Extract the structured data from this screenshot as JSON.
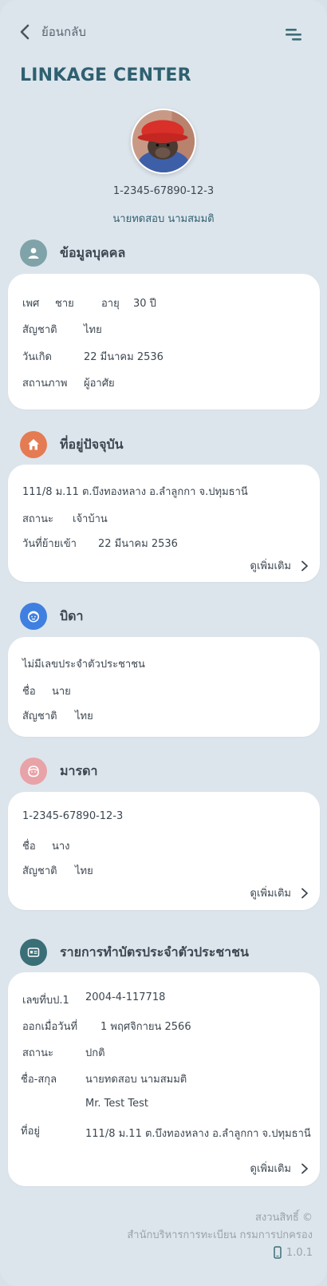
{
  "header": {
    "back_label": "ย้อนกลับ",
    "title": "LINKAGE CENTER"
  },
  "profile": {
    "id_number": "1-2345-67890-12-3",
    "name": "นายทดสอบ  นามสมมติ"
  },
  "personal": {
    "title": "ข้อมูลบุคคล",
    "icon": "person-icon",
    "icon_color": "#7fa3a8",
    "gender_label": "เพศ",
    "gender_value": "ชาย",
    "age_label": "อายุ",
    "age_value": "30  ปี",
    "nationality_label": "สัญชาติ",
    "nationality_value": "ไทย",
    "birthdate_label": "วันเกิด",
    "birthdate_value": "22  มีนาคม  2536",
    "status_label": "สถานภาพ",
    "status_value": "ผู้อาศัย"
  },
  "address": {
    "title": "ที่อยู่ปัจจุบัน",
    "icon": "home-icon",
    "icon_color": "#e57b52",
    "address_text": "111/8 ม.11 ต.บึงทองหลาง อ.ลำลูกกา จ.ปทุมธานี",
    "status_label": "สถานะ",
    "status_value": "เจ้าบ้าน",
    "movein_label": "วันที่ย้ายเข้า",
    "movein_value": "22 มีนาคม 2536",
    "more_label": "ดูเพิ่มเติม"
  },
  "father": {
    "title": "บิดา",
    "icon": "father-face-icon",
    "icon_color": "#3f7fe0",
    "id_text": "ไม่มีเลขประจำตัวประชาชน",
    "name_label": "ชื่อ",
    "name_value": "นาย",
    "nationality_label": "สัญชาติ",
    "nationality_value": "ไทย"
  },
  "mother": {
    "title": "มารดา",
    "icon": "mother-face-icon",
    "icon_color": "#e8a3a8",
    "id_text": "1-2345-67890-12-3",
    "name_label": "ชื่อ",
    "name_value": "นาง",
    "nationality_label": "สัญชาติ",
    "nationality_value": "ไทย",
    "more_label": "ดูเพิ่มเติม"
  },
  "idcard": {
    "title": "รายการทำบัตรประจำตัวประชาชน",
    "icon": "id-card-icon",
    "icon_color": "#3b6f78",
    "request_label": "เลขที่บป.1",
    "request_value": "2004-4-117718",
    "issued_label": "ออกเมื่อวันที่",
    "issued_value": "1 พฤศจิกายน 2566",
    "status_label": "สถานะ",
    "status_value": "ปกติ",
    "fullname_label": "ชื่อ-สกุล",
    "fullname_th": "นายทดสอบ  นามสมมติ",
    "fullname_en": "Mr. Test  Test",
    "address_label": "ที่อยู่",
    "address_value": "111/8 ม.11 ต.บึงทองหลาง อ.ลำลูกกา จ.ปทุมธานี",
    "more_label": "ดูเพิ่มเติม"
  },
  "footer": {
    "copyright": "สงวนสิทธิ์ ©",
    "org": "สำนักบริหารการทะเบียน กรมการปกครอง",
    "version": "1.0.1"
  }
}
